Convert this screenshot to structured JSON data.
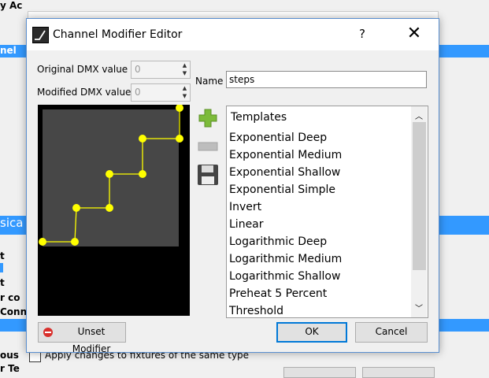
{
  "background": {
    "partial_top": "y Ac",
    "channel_row": "nel",
    "physical_row": "sica",
    "items": [
      "t",
      "t",
      "r co",
      "Conn"
    ],
    "bottom_rows": [
      "ous",
      "r Te"
    ],
    "apply_label": "Apply changes to fixtures of the same type"
  },
  "dialog": {
    "title": "Channel Modifier Editor",
    "help_label": "?",
    "close_label": "✕",
    "original_label": "Original DMX value",
    "original_value": "0",
    "modified_label": "Modified DMX value",
    "modified_value": "0",
    "name_label": "Name",
    "name_value": "steps",
    "templates": {
      "header": "Templates",
      "items": [
        "Exponential Deep",
        "Exponential Medium",
        "Exponential Shallow",
        "Exponential Simple",
        "Invert",
        "Linear",
        "Logarithmic Deep",
        "Logarithmic Medium",
        "Logarithmic Shallow",
        "Preheat 5 Percent",
        "Threshold"
      ]
    },
    "icons": {
      "add": "plus-icon",
      "remove": "minus-icon",
      "save": "floppy-disk-icon",
      "unset": "no-entry-icon"
    },
    "unset_label": "Unset Modifier",
    "ok_label": "OK",
    "cancel_label": "Cancel",
    "colors": {
      "curve": "#ffff00",
      "accent": "#0078d7",
      "add": "#7dbb3a"
    }
  }
}
